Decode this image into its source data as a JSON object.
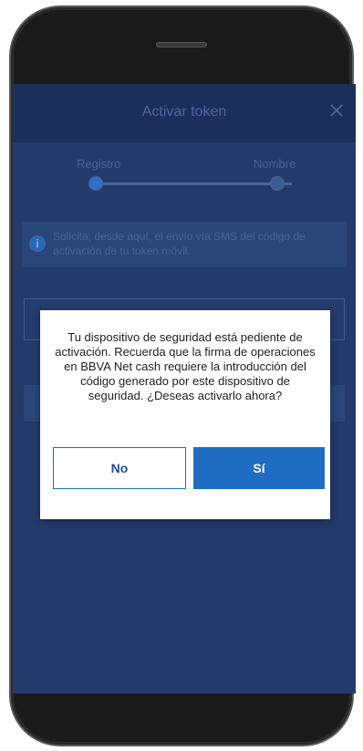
{
  "header": {
    "title": "Activar token"
  },
  "steps": {
    "labels": [
      "Registro",
      "Nombre"
    ],
    "active_step": 1,
    "total_steps": 2
  },
  "info": {
    "text": "Solicita, desde aquí, el envío vía SMS del código de activación de tu token móvil."
  },
  "dialog": {
    "message": "Tu dispositivo de seguridad está pediente de activación. Recuerda que la firma de operaciones en BBVA Net cash requiere la introducción del código generado por este dispositivo de seguridad. ¿Deseas activarlo ahora?",
    "no_label": "No",
    "yes_label": "Sí"
  },
  "colors": {
    "primary_button": "#1f6dc2",
    "app_background": "#233a6a",
    "header_background": "#1c2e5b"
  },
  "icons": {
    "close": "close-icon",
    "info": "info-icon"
  }
}
